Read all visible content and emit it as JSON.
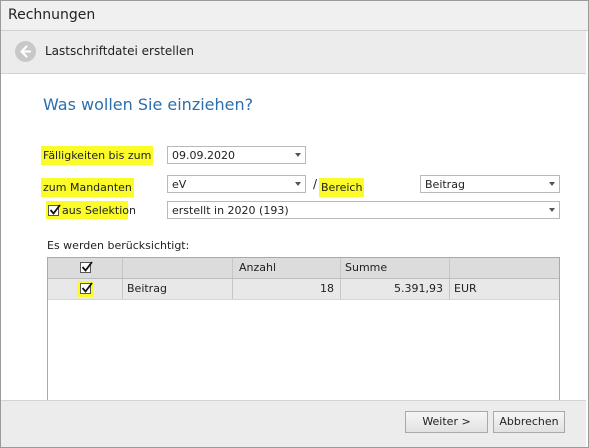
{
  "window": {
    "title": "Rechnungen"
  },
  "header": {
    "step_title": "Lastschriftdatei erstellen"
  },
  "question": "Was wollen Sie einziehen?",
  "form": {
    "faelligkeit_label": "Fälligkeiten bis zum",
    "faelligkeit_value": "09.09.2020",
    "mandant_label": "zum Mandanten",
    "mandant_value": "eV",
    "slash": "/",
    "bereich_label": "Bereich",
    "bereich_value": "Beitrag",
    "selektion_label": "aus Selektion",
    "selektion_checked": true,
    "selektion_value": "erstellt in 2020 (193)"
  },
  "table": {
    "caption": "Es werden berücksichtigt:",
    "columns": [
      "",
      "",
      "Anzahl",
      "Summe",
      ""
    ],
    "rows": [
      {
        "checked": true,
        "bereich": "Beitrag",
        "anzahl": "18",
        "summe": "5.391,93",
        "waehrung": "EUR"
      }
    ]
  },
  "footer": {
    "next_label": "Weiter >",
    "cancel_label": "Abbrechen"
  },
  "colors": {
    "highlight": "#fbfb2a",
    "accent": "#2b6fae"
  },
  "icons": {
    "back": "back-arrow-circle-icon",
    "check": "checkmark-icon"
  }
}
